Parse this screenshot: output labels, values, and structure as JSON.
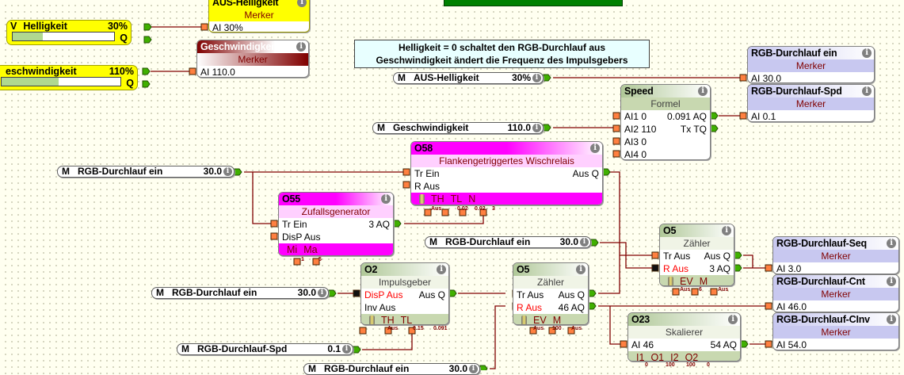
{
  "note": {
    "lines": [
      "Helligkeit = 0 schaltet den RGB-Durchlauf aus",
      "Geschwindigkeit ändert die Frequenz des Impulsgebers"
    ]
  },
  "variables": [
    {
      "id": "v1",
      "prefix": "V",
      "name": "Helligkeit",
      "value": "30%",
      "q": "Q",
      "fill_fraction": 0.3
    },
    {
      "id": "v2",
      "prefix": "",
      "name": "eschwindigkeit",
      "value": "110%",
      "q": "Q",
      "fill_fraction": 0.48
    }
  ],
  "merkers": [
    {
      "id": "mk1",
      "title": "AUS-Helligkeit",
      "type": "Merker",
      "input": "AI 30%",
      "theme": "m-yel"
    },
    {
      "id": "mk2",
      "title": "Geschwindigkeit",
      "type": "Merker",
      "input": "AI 110.0",
      "theme": "m-red"
    },
    {
      "id": "mk3",
      "title": "RGB-Durchlauf ein",
      "type": "Merker",
      "input": "AI 30.0",
      "theme": "m-lav"
    },
    {
      "id": "mk4",
      "title": "RGB-Durchlauf-Spd",
      "type": "Merker",
      "input": "AI 0.1",
      "theme": "m-lav"
    },
    {
      "id": "mk5",
      "title": "RGB-Durchlauf-Seq",
      "type": "Merker",
      "input": "AI 3.0",
      "theme": "m-lav"
    },
    {
      "id": "mk6",
      "title": "RGB-Durchlauf-Cnt",
      "type": "Merker",
      "input": "AI 46.0",
      "theme": "m-lav"
    },
    {
      "id": "mk7",
      "title": "RGB-Durchlauf-CInv",
      "type": "Merker",
      "input": "AI 54.0",
      "theme": "m-lav"
    }
  ],
  "refs": [
    {
      "id": "r1",
      "prefix": "M",
      "name": "AUS-Helligkeit",
      "value": "30%"
    },
    {
      "id": "r2",
      "prefix": "M",
      "name": "Geschwindigkeit",
      "value": "110.0"
    },
    {
      "id": "r3",
      "prefix": "M",
      "name": "RGB-Durchlauf ein",
      "value": "30.0"
    },
    {
      "id": "r4",
      "prefix": "M",
      "name": "RGB-Durchlauf ein",
      "value": "30.0"
    },
    {
      "id": "r5",
      "prefix": "M",
      "name": "RGB-Durchlauf ein",
      "value": "30.0"
    },
    {
      "id": "r6",
      "prefix": "M",
      "name": "RGB-Durchlauf-Spd",
      "value": "0.1"
    },
    {
      "id": "r7",
      "prefix": "M",
      "name": "RGB-Durchlauf ein",
      "value": "30.0"
    }
  ],
  "blocks": [
    {
      "id": "speed",
      "title": "Speed",
      "type": "Formel",
      "theme": "th-grn th-speed",
      "rows": [
        [
          "AI1 0",
          "0.091 AQ"
        ],
        [
          "AI2 110",
          "Tx TQ"
        ],
        [
          "AI3 0",
          ""
        ],
        [
          "AI4 0",
          ""
        ]
      ],
      "params": [],
      "param_values": []
    },
    {
      "id": "o58",
      "title": "O58",
      "type": "Flankengetriggertes Wischrelais",
      "theme": "th-mag",
      "rows": [
        [
          "Tr Ein",
          "Aus Q"
        ],
        [
          "R Aus",
          ""
        ]
      ],
      "battery": true,
      "params": [
        "TH",
        "TL",
        "N"
      ],
      "param_values": [
        "Aus",
        "0.02",
        "0.02",
        "3"
      ]
    },
    {
      "id": "o55",
      "title": "O55",
      "type": "Zufallsgenerator",
      "theme": "th-mag",
      "rows": [
        [
          "Tr Ein",
          "3 AQ"
        ],
        [
          "DisP Aus",
          ""
        ]
      ],
      "params": [
        "Mi",
        "Ma"
      ],
      "param_values": [
        "1",
        "5"
      ]
    },
    {
      "id": "o5r",
      "title": "O5",
      "type": "Zähler",
      "theme": "th-grn",
      "rows": [
        [
          "Tr Aus",
          "Aus Q"
        ],
        [
          "R Aus",
          "3 AQ"
        ]
      ],
      "red_rows": [
        1
      ],
      "battery": true,
      "params": [
        "EV",
        "M"
      ],
      "param_values": [
        "Aus",
        "6",
        "Aus"
      ]
    },
    {
      "id": "o2",
      "title": "O2",
      "type": "Impulsgeber",
      "theme": "th-grn",
      "rows": [
        [
          "DisP Aus",
          "Aus Q"
        ],
        [
          "Inv Aus",
          ""
        ]
      ],
      "red_rows": [
        0
      ],
      "battery": true,
      "params": [
        "TH",
        "TL"
      ],
      "param_values": [
        "Aus",
        "0.15",
        "0.091"
      ]
    },
    {
      "id": "o5m",
      "title": "O5",
      "type": "Zähler",
      "theme": "th-grn",
      "rows": [
        [
          "Tr Aus",
          "Aus Q"
        ],
        [
          "R Aus",
          "46 AQ"
        ]
      ],
      "red_rows": [
        1
      ],
      "battery": true,
      "params": [
        "EV",
        "M"
      ],
      "param_values": [
        "Aus",
        "100",
        "Aus"
      ]
    },
    {
      "id": "o23",
      "title": "O23",
      "type": "Skalierer",
      "theme": "th-grn",
      "rows": [
        [
          "AI 46",
          "54 AQ"
        ]
      ],
      "params": [
        "I1",
        "O1",
        "I2",
        "O2"
      ],
      "param_values": [
        "0",
        "100",
        "100",
        "0"
      ]
    }
  ],
  "colors": {
    "wire": "#800000",
    "input_connector": "#ff8040",
    "output_connector": "#40b000",
    "green_bar": "#008000"
  }
}
